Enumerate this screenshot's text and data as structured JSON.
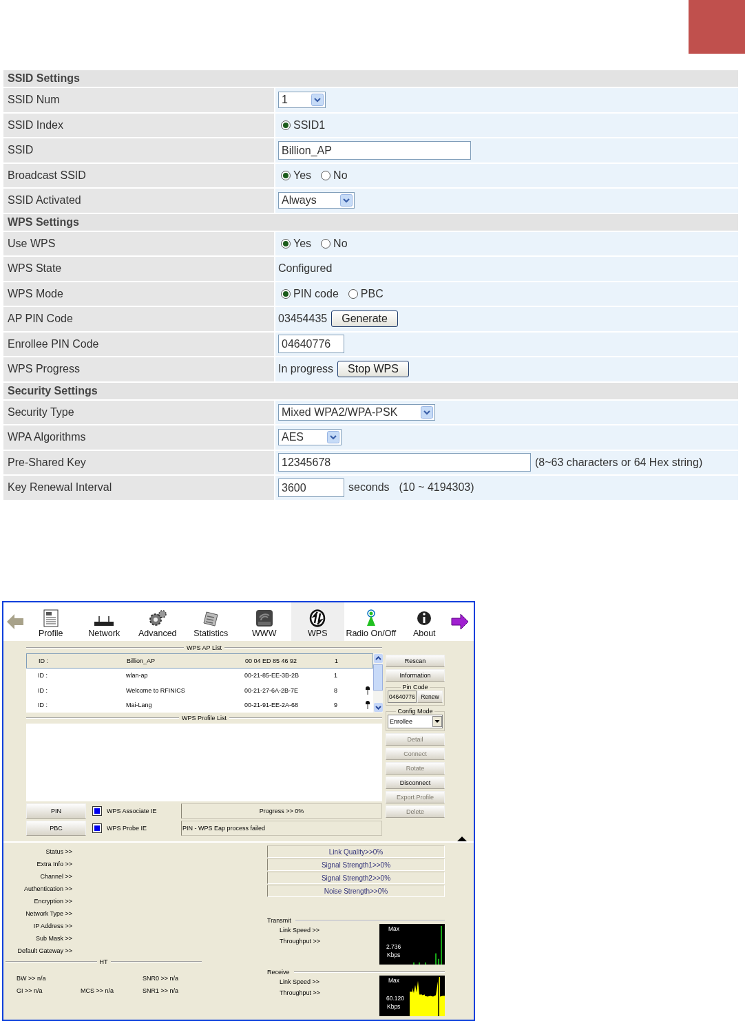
{
  "settings": {
    "rows": [
      {
        "kind": "header",
        "label": "SSID Settings"
      },
      {
        "kind": "select",
        "label": "SSID Num",
        "value": "1"
      },
      {
        "kind": "radio",
        "label": "SSID Index",
        "options": [
          {
            "label": "SSID1",
            "selected": true
          }
        ]
      },
      {
        "kind": "wide_input",
        "label": "SSID",
        "value": "Billion_AP"
      },
      {
        "kind": "radio",
        "label": "Broadcast SSID",
        "options": [
          {
            "label": "Yes",
            "selected": true
          },
          {
            "label": "No",
            "selected": false
          }
        ]
      },
      {
        "kind": "select",
        "label": "SSID Activated",
        "value": "Always"
      },
      {
        "kind": "header",
        "label": "WPS Settings"
      },
      {
        "kind": "radio",
        "label": "Use WPS",
        "options": [
          {
            "label": "Yes",
            "selected": true
          },
          {
            "label": "No",
            "selected": false
          }
        ]
      },
      {
        "kind": "text",
        "label": "WPS State",
        "value": "Configured"
      },
      {
        "kind": "radio",
        "label": "WPS Mode",
        "options": [
          {
            "label": "PIN code",
            "selected": true
          },
          {
            "label": "PBC",
            "selected": false
          }
        ]
      },
      {
        "kind": "text",
        "label": "AP PIN Code",
        "value": "03454435",
        "button": "Generate"
      },
      {
        "kind": "input",
        "label": "Enrollee PIN Code",
        "value": "04640776"
      },
      {
        "kind": "text",
        "label": "WPS Progress",
        "value": "In progress",
        "button": "Stop WPS"
      },
      {
        "kind": "header",
        "label": "Security Settings"
      },
      {
        "kind": "select",
        "label": "Security Type",
        "value": "Mixed WPA2/WPA-PSK"
      },
      {
        "kind": "select",
        "label": "WPA Algorithms",
        "value": "AES"
      },
      {
        "kind": "wide_input",
        "label": "Pre-Shared Key",
        "value": "12345678",
        "notes": [
          "(8~63 characters or 64 Hex string)"
        ]
      },
      {
        "kind": "input",
        "label": "Key Renewal Interval",
        "value": "3600",
        "notes": [
          "seconds",
          "(10 ~ 4194303)"
        ]
      }
    ]
  },
  "utility": {
    "toolbar": [
      {
        "label": "Profile",
        "selected": false
      },
      {
        "label": "Network",
        "selected": false
      },
      {
        "label": "Advanced",
        "selected": false
      },
      {
        "label": "Statistics",
        "selected": false
      },
      {
        "label": "WWW",
        "selected": false
      },
      {
        "label": "WPS",
        "selected": true
      },
      {
        "label": "Radio On/Off",
        "selected": false
      },
      {
        "label": "About",
        "selected": false
      }
    ],
    "ap_list": {
      "title": "WPS AP List",
      "rows": [
        {
          "id": "ID :",
          "ssid": "Billion_AP",
          "bssid": "00 04 ED 85 46 92",
          "channel": "1",
          "locked": false,
          "selected": true
        },
        {
          "id": "ID :",
          "ssid": "wlan-ap",
          "bssid": "00-21-85-EE-3B-2B",
          "channel": "1",
          "locked": false,
          "selected": false
        },
        {
          "id": "ID :",
          "ssid": "Welcome to RFINICS",
          "bssid": "00-21-27-6A-2B-7E",
          "channel": "8",
          "locked": true,
          "selected": false
        },
        {
          "id": "ID :",
          "ssid": "Mai-Lang",
          "bssid": "00-21-91-EE-2A-68",
          "channel": "9",
          "locked": true,
          "selected": false
        }
      ]
    },
    "side_top": [
      {
        "label": "Rescan",
        "disabled": false
      },
      {
        "label": "Information",
        "disabled": false
      }
    ],
    "pin_code": {
      "title": "Pin Code",
      "value": "04640776",
      "button": "Renew"
    },
    "config_mode": {
      "title": "Config Mode",
      "value": "Enrollee"
    },
    "side_bottom": [
      {
        "label": "Detail",
        "disabled": true
      },
      {
        "label": "Connect",
        "disabled": true
      },
      {
        "label": "Rotate",
        "disabled": true
      },
      {
        "label": "Disconnect",
        "disabled": false
      },
      {
        "label": "Export Profile",
        "disabled": true
      },
      {
        "label": "Delete",
        "disabled": true
      }
    ],
    "profile_list": {
      "title": "WPS Profile List"
    },
    "actions": [
      {
        "kind": "progress",
        "button": "PIN",
        "option": "WPS Associate IE",
        "checked": true,
        "status": "Progress >> 0%"
      },
      {
        "kind": "message",
        "button": "PBC",
        "option": "WPS Probe IE",
        "checked": true,
        "status": "PIN - WPS Eap process failed"
      }
    ],
    "status_labels": [
      "Status >>",
      "Extra Info >>",
      "Channel >>",
      "Authentication >>",
      "Encryption >>",
      "Network Type >>",
      "IP Address >>",
      "Sub Mask >>",
      "Default Gateway >>"
    ],
    "ht": {
      "title": "HT",
      "rows": [
        {
          "col_1": "BW >> n/a",
          "col_3": "SNR0 >> n/a"
        },
        {
          "col_1": "GI >> n/a",
          "col_2": "MCS >> n/a",
          "col_3": "SNR1 >> n/a"
        }
      ]
    },
    "meters": [
      {
        "label": "Link Quality>>0%",
        "level": 0
      },
      {
        "label": "Signal Strength1>>0%",
        "level": 0
      },
      {
        "label": "Signal Strength2>>0%",
        "level": 0
      },
      {
        "label": "Noise Strength>>0%",
        "level": 0
      }
    ],
    "traffic": [
      {
        "title": "Transmit",
        "labels": [
          "Link Speed >>",
          "Throughput >>"
        ],
        "graph": {
          "max": "Max",
          "value": "2.736",
          "unit": "Kbps"
        }
      },
      {
        "title": "Receive",
        "labels": [
          "Link Speed >>",
          "Throughput >>"
        ],
        "graph": {
          "max": "Max",
          "value": "60.120",
          "unit": "Kbps"
        }
      }
    ]
  }
}
